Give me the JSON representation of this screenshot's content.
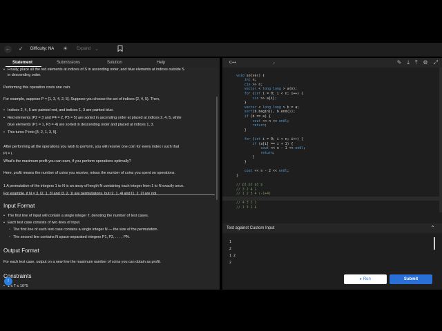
{
  "header": {
    "difficulty": "Difficulty: NA",
    "expand_label": "Expand"
  },
  "tabs": [
    "Statement",
    "Submissions",
    "Solution",
    "Help"
  ],
  "statement": {
    "lines": [
      {
        "text": "Finally, place all the red elements at indices of S in ascending order, and blue elements at indices outside S",
        "kind": "bullet"
      },
      {
        "text": "in descending order.",
        "kind": "plain-indent"
      },
      {
        "text": "Performing this operation costs one coin.",
        "kind": "plain"
      },
      {
        "text": "For example, suppose P = [1, 3, 4, 2, 5]. Suppose you choose the set of indices {2, 4, 5}. Then,",
        "kind": "plain"
      },
      {
        "text": "Indices 2, 4, 5 are painted red, and indices 1, 3 are painted blue.",
        "kind": "bullet"
      },
      {
        "text": "Red elements (P2 = 3 and P4 = 2, P5 = 5) are sorted in ascending order at placed at indices 2, 4, 5, while",
        "kind": "bullet"
      },
      {
        "text": "blue elements (P1 = 1, P3 = 4) are sorted in descending order and placed at indices 1, 3.",
        "kind": "plain-indent"
      },
      {
        "text": "This turns P into [4, 2, 1, 3, 5].",
        "kind": "bullet"
      },
      {
        "text": "After performing all the operations you wish to perform, you will receive one coin for every index i such that",
        "kind": "plain"
      },
      {
        "text": "Pi = i.",
        "kind": "plain"
      },
      {
        "text": "What's the maximum profit you can earn, if you perform operations optimally?",
        "kind": "plain"
      },
      {
        "text": "Here, profit means the number of coins you receive, minus the number of coins you spent on operations.",
        "kind": "plain"
      },
      {
        "text": "1 A permutation of the integers 1 to N is an array of length N containing each integer from 1 to N exactly once.",
        "kind": "plain"
      },
      {
        "text": "For example, if N = 3, [2, 1, 3] and [3, 2, 1] are permutations, but [2, 1, 4] and [1, 2, 2] are not.",
        "kind": "plain"
      }
    ],
    "input_format_title": "Input Format",
    "input_lines": [
      {
        "text": "The first line of input will contain a single integer T, denoting the number of test cases.",
        "kind": "bullet"
      },
      {
        "text": "Each test case consists of two lines of input.",
        "kind": "bullet"
      },
      {
        "text": "The first line of each test case contains a single integer N — the size of the permutation.",
        "kind": "sub"
      },
      {
        "text": "The second line contains N space-separated integers P1, P2, . . . , PN.",
        "kind": "sub"
      }
    ],
    "output_format_title": "Output Format",
    "output_text": "For each test case, output on a new line the maximum number of coins you can obtain as profit.",
    "constraints_title": "Constraints",
    "constraints_first": "1 ≤ T ≤ 10^5"
  },
  "editor": {
    "language": "C++",
    "code_lines": [
      "",
      "void solve() {",
      "    int n;",
      "    cin >> n;",
      "    vector < long long > a(n);",
      "    for (int i = 0; i < n; i++) {",
      "        cin >> a[i];",
      "    }",
      "    vector < long long > b = a;",
      "    sort(b.begin(), b.end());",
      "    if (b == a) {",
      "        cout << n << endl;",
      "        return;",
      "    }",
      "",
      "    for (int i = 0; i < n; i++) {",
      "        if (a[i] == i + 1) {",
      "            cout << n - 1 << endl;",
      "            return;",
      "        }",
      "    }",
      "",
      "    cout << n - 2 << endl;",
      "}",
      "",
      "// p1 p2 p3 p",
      "// 3 2 4 1",
      "// 1 2 3 4 (-1+4)",
      "",
      "// 4 3 2 1",
      "// 1 3 2 4"
    ],
    "line_numbers": [
      "5",
      "6",
      "7",
      "8",
      "9",
      "10",
      "11",
      "12",
      "13",
      "14",
      "15",
      "16",
      "17",
      "18",
      "19",
      "20",
      "21",
      "22",
      "23",
      "24",
      "25",
      "26",
      "27",
      "28",
      "29",
      "30",
      "31",
      "32",
      "33",
      "34",
      "35"
    ]
  },
  "custom_input": {
    "title": "Test against Custom Input",
    "lines": [
      "1",
      "2",
      "1 2",
      "2"
    ]
  },
  "buttons": {
    "run": "Run",
    "submit": "Submit"
  }
}
